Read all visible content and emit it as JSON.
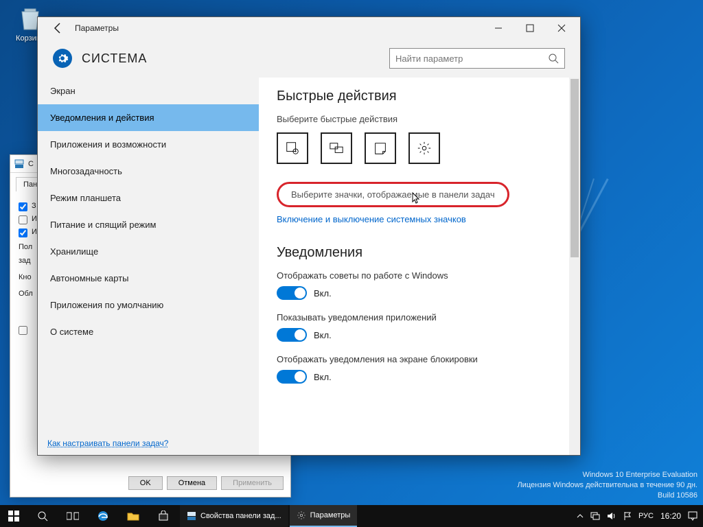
{
  "desktop": {
    "recycle_bin": "Корзина"
  },
  "watermark": {
    "line1": "Windows 10 Enterprise Evaluation",
    "line2": "Лицензия Windows действительна в течение 90 дн.",
    "line3": "Build 10586"
  },
  "bg_dialog": {
    "title_abbrev": "С",
    "crumb": "Пане",
    "tab": "Пане",
    "checkbox1": "З",
    "checkbox2": "И",
    "group1": "Пол",
    "group1b": "зад",
    "group2": "Кно",
    "group3": "Обл",
    "btn_ok": "OK",
    "btn_cancel": "Отмена",
    "btn_apply": "Применить"
  },
  "settings": {
    "window_title": "Параметры",
    "header": "СИСТЕМА",
    "search_placeholder": "Найти параметр",
    "sidebar": {
      "items": [
        "Экран",
        "Уведомления и действия",
        "Приложения и возможности",
        "Многозадачность",
        "Режим планшета",
        "Питание и спящий режим",
        "Хранилище",
        "Автономные карты",
        "Приложения по умолчанию",
        "О системе"
      ],
      "selected_index": 1,
      "help_link": "Как настраивать панели задач?"
    },
    "main": {
      "quick_actions_heading": "Быстрые действия",
      "quick_actions_sub": "Выберите быстрые действия",
      "link_taskbar_icons": "Выберите значки, отображаемые в панели задач",
      "link_system_icons": "Включение и выключение системных значков",
      "notifications_heading": "Уведомления",
      "toggles": [
        {
          "label": "Отображать советы по работе с Windows",
          "state": "Вкл."
        },
        {
          "label": "Показывать уведомления приложений",
          "state": "Вкл."
        },
        {
          "label": "Отображать уведомления на экране блокировки",
          "state": "Вкл."
        }
      ]
    }
  },
  "taskbar": {
    "task1": "Свойства панели зад...",
    "task2": "Параметры",
    "lang": "РУС",
    "clock": "16:20"
  }
}
